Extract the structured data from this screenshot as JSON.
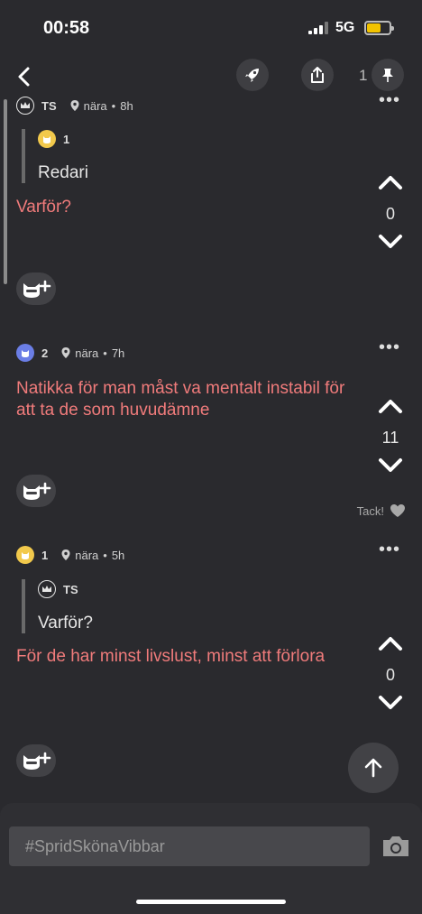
{
  "status": {
    "time": "00:58",
    "network": "5G"
  },
  "header": {
    "pin_count": "1"
  },
  "posts": [
    {
      "author": "TS",
      "location": "nära",
      "age": "8h",
      "quote": {
        "author": "1",
        "text": "Redari"
      },
      "text": "Varför?",
      "votes": "0"
    },
    {
      "author": "2",
      "location": "nära",
      "age": "7h",
      "text": "Natikka för man måst va mentalt instabil för att ta de som huvudämne",
      "votes": "11",
      "thanks_label": "Tack!"
    },
    {
      "author": "1",
      "location": "nära",
      "age": "5h",
      "quote": {
        "author": "TS",
        "text": "Varför?"
      },
      "text": "För de har minst livslust, minst att förlora",
      "votes": "0"
    }
  ],
  "composer": {
    "placeholder": "#SpridSkönaVibbar"
  },
  "colors": {
    "accent": "#f07b7b",
    "background": "#2a2a2e",
    "author_yellow": "#f2c94c",
    "author_purple": "#6b7ee6"
  },
  "icons": [
    "back-chevron-icon",
    "rocket-icon",
    "share-icon",
    "pin-icon",
    "crown-icon",
    "cat-icon",
    "location-pin-icon",
    "more-dots-icon",
    "chevron-up-icon",
    "chevron-down-icon",
    "cat-add-icon",
    "heart-icon",
    "arrow-up-icon",
    "camera-icon"
  ]
}
